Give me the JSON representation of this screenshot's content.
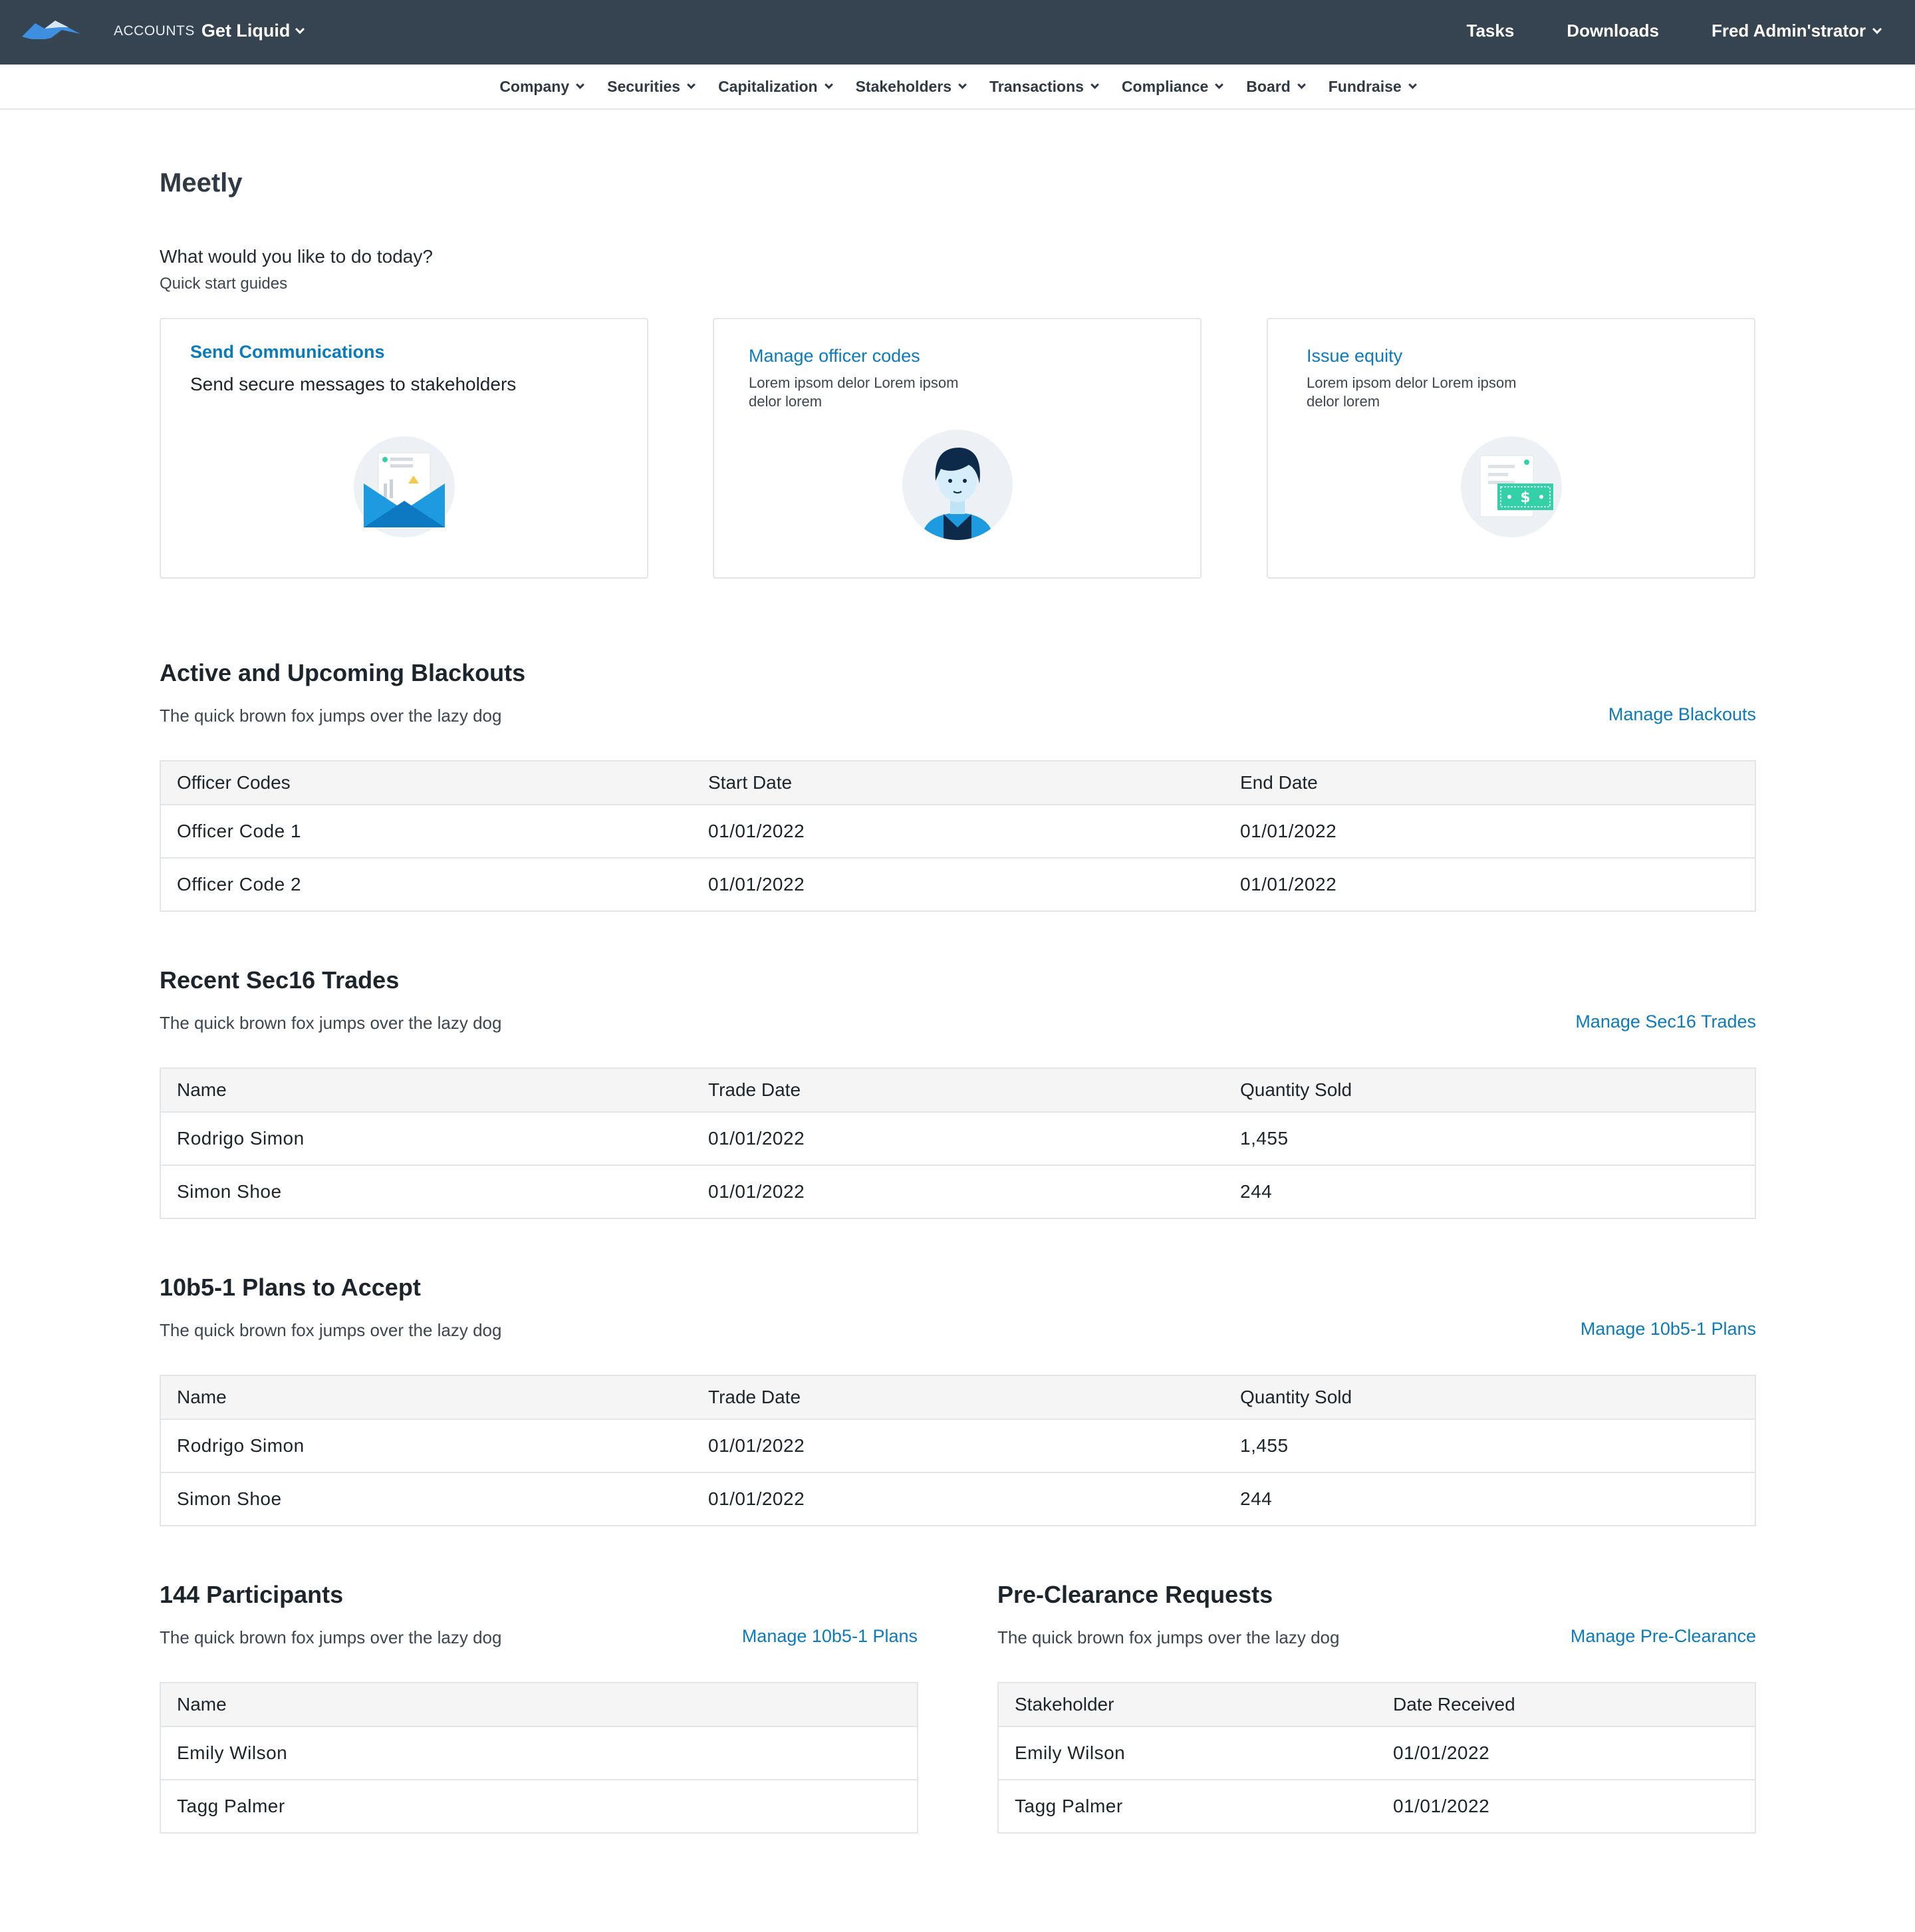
{
  "header": {
    "account_label": "ACCOUNTS",
    "account_name": "Get Liquid",
    "nav": {
      "tasks": "Tasks",
      "downloads": "Downloads",
      "user": "Fred Admin'strator"
    }
  },
  "subnav": [
    "Company",
    "Securities",
    "Capitalization",
    "Stakeholders",
    "Transactions",
    "Compliance",
    "Board",
    "Fundraise"
  ],
  "page": {
    "company": "Meetly",
    "question": "What would you like to do today?",
    "quick_start": "Quick start guides"
  },
  "cards": [
    {
      "title": "Send Communications",
      "desc": "Send secure messages to stakeholders",
      "icon": "envelope-icon"
    },
    {
      "title": "Manage officer codes",
      "desc": "Lorem ipsom delor Lorem ipsom delor lorem",
      "icon": "officer-avatar-icon"
    },
    {
      "title": "Issue equity",
      "desc": "Lorem ipsom delor Lorem ipsom delor lorem",
      "icon": "cash-document-icon"
    }
  ],
  "blackouts": {
    "title": "Active and Upcoming Blackouts",
    "subtitle": "The quick brown fox jumps over the lazy dog",
    "link": "Manage Blackouts",
    "columns": [
      "Officer Codes",
      "Start Date",
      "End Date"
    ],
    "rows": [
      [
        "Officer Code 1",
        "01/01/2022",
        "01/01/2022"
      ],
      [
        "Officer Code 2",
        "01/01/2022",
        "01/01/2022"
      ]
    ]
  },
  "sec16": {
    "title": "Recent Sec16 Trades",
    "subtitle": "The quick brown fox jumps over the lazy dog",
    "link": "Manage Sec16 Trades",
    "columns": [
      "Name",
      "Trade Date",
      "Quantity Sold"
    ],
    "rows": [
      [
        "Rodrigo Simon",
        "01/01/2022",
        "1,455"
      ],
      [
        "Simon Shoe",
        "01/01/2022",
        "244"
      ]
    ]
  },
  "plans": {
    "title": "10b5-1 Plans to Accept",
    "subtitle": "The quick brown fox jumps over the lazy dog",
    "link": "Manage 10b5-1 Plans",
    "columns": [
      "Name",
      "Trade Date",
      "Quantity Sold"
    ],
    "rows": [
      [
        "Rodrigo Simon",
        "01/01/2022",
        "1,455"
      ],
      [
        "Simon Shoe",
        "01/01/2022",
        "244"
      ]
    ]
  },
  "participants": {
    "title": "144 Participants",
    "subtitle": "The quick brown fox jumps over the lazy dog",
    "link": "Manage 10b5-1 Plans",
    "columns": [
      "Name"
    ],
    "rows": [
      [
        "Emily Wilson"
      ],
      [
        "Tagg Palmer"
      ]
    ]
  },
  "preclearance": {
    "title": "Pre-Clearance Requests",
    "subtitle": "The quick brown fox jumps over the lazy dog",
    "link": "Manage Pre-Clearance",
    "columns": [
      "Stakeholder",
      "Date Received"
    ],
    "rows": [
      [
        "Emily Wilson",
        "01/01/2022"
      ],
      [
        "Tagg Palmer",
        "01/01/2022"
      ]
    ]
  },
  "colors": {
    "topbar": "#364351",
    "link": "#0b7bbd",
    "accent_blue": "#1e9be0",
    "accent_green": "#34d1a8"
  }
}
